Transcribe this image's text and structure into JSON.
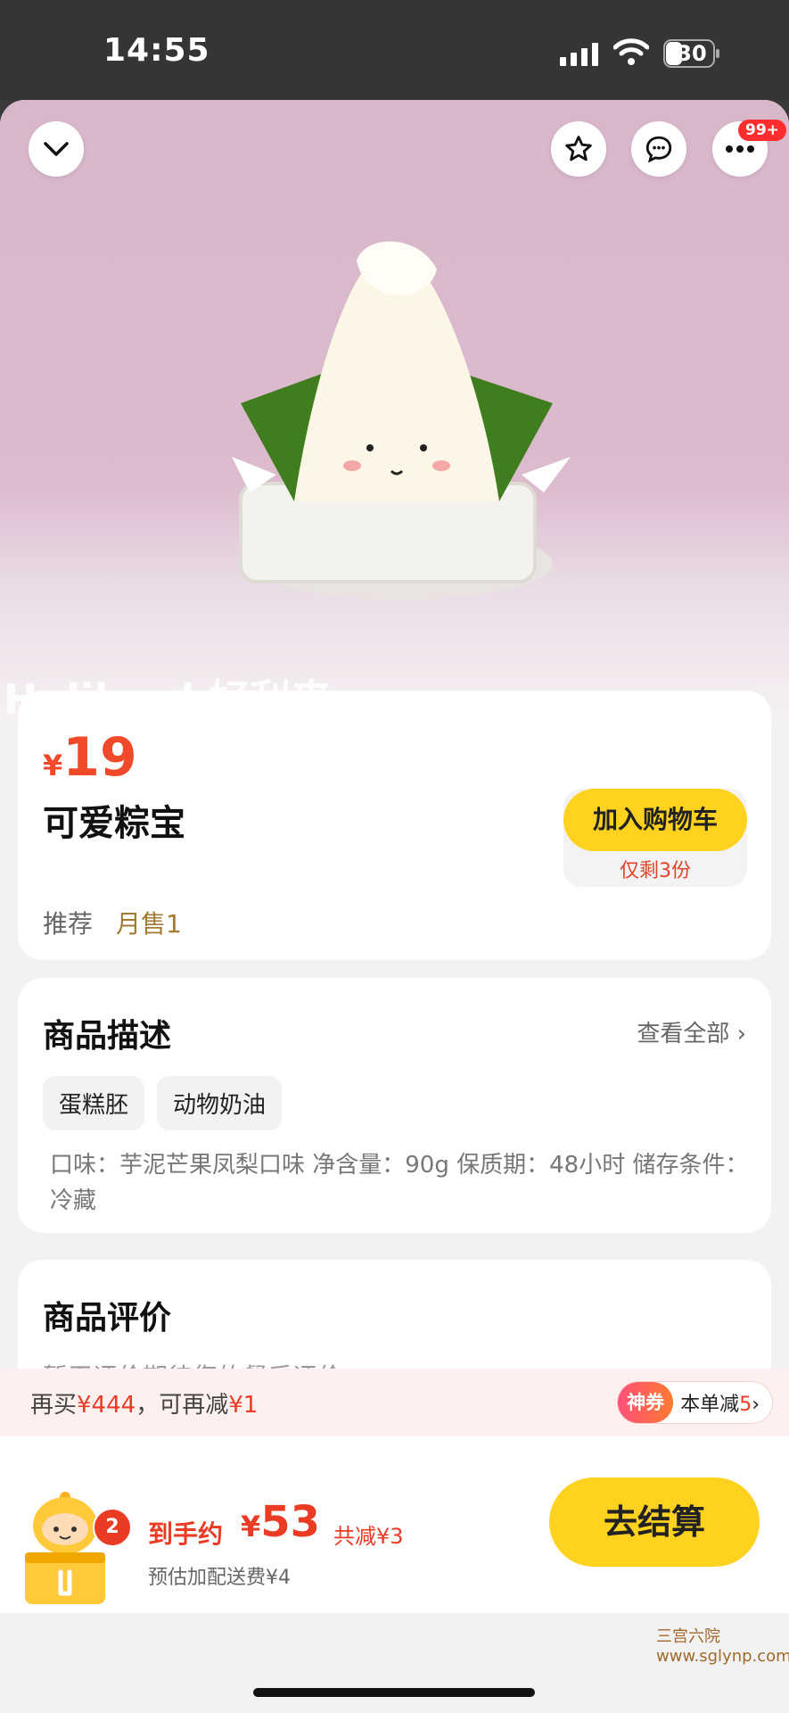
{
  "status_bar": {
    "time": "14:55",
    "battery": "30"
  },
  "hero": {
    "brand_text": "Holiland 好利来"
  },
  "top_actions": {
    "more_badge": "99+"
  },
  "product": {
    "price_symbol": "¥",
    "price": "19",
    "name": "可爱粽宝",
    "tag_recommend": "推荐",
    "monthly_sales": "月售1",
    "cart_button": "加入购物车",
    "stock_note": "仅剩3份"
  },
  "description": {
    "title": "商品描述",
    "view_all": "查看全部 ›",
    "chips": [
      "蛋糕胚",
      "动物奶油"
    ],
    "text": "口味：芋泥芒果凤梨口味 净含量：90g 保质期：48小时 储存条件：冷藏"
  },
  "reviews": {
    "title": "商品评价",
    "empty_text": "暂无评价期待您的餐后评价"
  },
  "promo": {
    "prefix": "再买",
    "amount": "¥444",
    "middle": "，可再减",
    "discount": "¥1",
    "pill_badge": "神券",
    "pill_text": "本单减",
    "pill_value": "5",
    "pill_arrow": "›"
  },
  "checkout": {
    "cart_count": "2",
    "net_label": "到手约",
    "price_symbol": "¥",
    "price": "53",
    "saved": "共减¥3",
    "delivery_fee": "预估加配送费¥4",
    "button": "去结算"
  },
  "watermark": "三宫六院 www.sglynp.com",
  "colors": {
    "accent_yellow": "#ffd21f",
    "price_red": "#f04a2b",
    "hero_bg": "#d8b7cb"
  }
}
